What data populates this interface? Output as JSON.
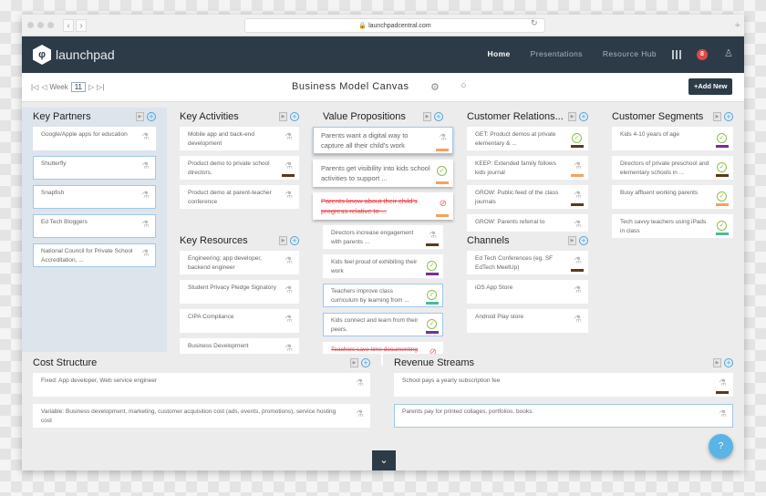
{
  "browser": {
    "url": "launchpadcentral.com"
  },
  "nav": {
    "brand": "launchpad",
    "links": [
      "Home",
      "Presentations",
      "Resource Hub"
    ],
    "notifications": "8"
  },
  "toolbar": {
    "week_label": "Week",
    "week": "11",
    "title": "Business Model Canvas",
    "add_new": "+Add New"
  },
  "colors": {
    "orange": "#f5a25d",
    "brown": "#5a3a1a",
    "purple": "#7b2d8e",
    "teal": "#4fb99f",
    "accent": "#4aa3df",
    "nav": "#2d3b48"
  },
  "sections": {
    "key_partners": {
      "title": "Key Partners",
      "cards": [
        {
          "text": "Google/Apple apps for education",
          "icon": "flask"
        },
        {
          "text": "Shutterfly",
          "icon": "flask",
          "selected": true
        },
        {
          "text": "Snapfish",
          "icon": "flask",
          "selected": true
        },
        {
          "text": "Ed Tech Bloggers",
          "icon": "flask",
          "selected": true
        },
        {
          "text": "National Council for Private School Accreditation, ...",
          "icon": "flask",
          "selected": true
        }
      ]
    },
    "key_activities": {
      "title": "Key Activities",
      "cards": [
        {
          "text": "Mobile app and back-end development",
          "icon": "flask"
        },
        {
          "text": "Product demo to private school directors.",
          "icon": "flask",
          "bar": "brown"
        },
        {
          "text": "Product demo at parent-teacher conference",
          "icon": "flask"
        }
      ]
    },
    "key_resources": {
      "title": "Key Resources",
      "cards": [
        {
          "text": "Engineering: app developer, backend engineer",
          "icon": "flask"
        },
        {
          "text": "Student Privacy Pledge Signatory",
          "icon": "flask"
        },
        {
          "text": "CIPA Compliance",
          "icon": "flask"
        },
        {
          "text": "Business Development",
          "icon": "flask"
        }
      ]
    },
    "value_propositions": {
      "title": "Value Propositions",
      "cards": [
        {
          "text": "Parents want a digital way to capture all their child's work",
          "icon": "flask",
          "bar": "orange",
          "wide": true,
          "selected": true
        },
        {
          "text": "Parents get visibility into kids school activities to support ...",
          "icon": "check",
          "bar": "orange",
          "wide": true
        },
        {
          "text": "Parents know about their child's progress relative to ...",
          "icon": "ban",
          "bar": "orange",
          "wide": true,
          "struck": true
        },
        {
          "text": "Directors increase engagement with parents ...",
          "icon": "flask",
          "bar": "brown"
        },
        {
          "text": "Kids feel proud of exhibiting their work",
          "icon": "check",
          "bar": "purple"
        },
        {
          "text": "Teachers improve class curriculum by learning from ...",
          "icon": "check",
          "bar": "teal",
          "selected": true
        },
        {
          "text": "Kids connect and learn from their peers.",
          "icon": "check",
          "bar": "purple",
          "selected": true
        },
        {
          "text": "Teachers save time documenting kids progress",
          "icon": "ban",
          "struck": true
        }
      ]
    },
    "customer_relationships": {
      "title": "Customer Relations...",
      "cards": [
        {
          "text": "GET: Product demos at private elementary & ...",
          "icon": "check",
          "bar": "brown"
        },
        {
          "text": "KEEP: Extended family follows kids journal",
          "icon": "flask",
          "bar": "orange"
        },
        {
          "text": "GROW: Public feed of the class journals",
          "icon": "flask",
          "bar": "brown"
        },
        {
          "text": "GROW: Parents referral to",
          "icon": "flask"
        }
      ]
    },
    "channels": {
      "title": "Channels",
      "cards": [
        {
          "text": "Ed Tech Conferences (eg. SF EdTech MeetUp)",
          "icon": "flask",
          "bar": "brown"
        },
        {
          "text": "iOS App Store",
          "icon": "flask"
        },
        {
          "text": "Android Play store",
          "icon": "flask"
        }
      ]
    },
    "customer_segments": {
      "title": "Customer Segments",
      "cards": [
        {
          "text": "Kids 4-10 years of age",
          "icon": "check",
          "bar": "purple"
        },
        {
          "text": "Directors of private preschool and elementary schools in ...",
          "icon": "check",
          "bar": "brown"
        },
        {
          "text": "Busy affluent working parents",
          "icon": "check",
          "bar": "orange"
        },
        {
          "text": "Tech savvy teachers using iPads in class",
          "icon": "check",
          "bar": "teal"
        }
      ]
    },
    "cost_structure": {
      "title": "Cost Structure",
      "cards": [
        {
          "text": "Fixed: App developer, Web service engineer",
          "icon": "flask"
        },
        {
          "text": "Variable: Business development, marketing, customer acquisition cost (ads, events, promotions), service hosting cost",
          "icon": "flask"
        }
      ]
    },
    "revenue_streams": {
      "title": "Revenue Streams",
      "cards": [
        {
          "text": "School pays a yearly subscription fee",
          "icon": "flask",
          "bar": "brown"
        },
        {
          "text": "Parents pay for printed collages, portfolios, books.",
          "icon": "flask",
          "selected": true
        }
      ]
    }
  }
}
